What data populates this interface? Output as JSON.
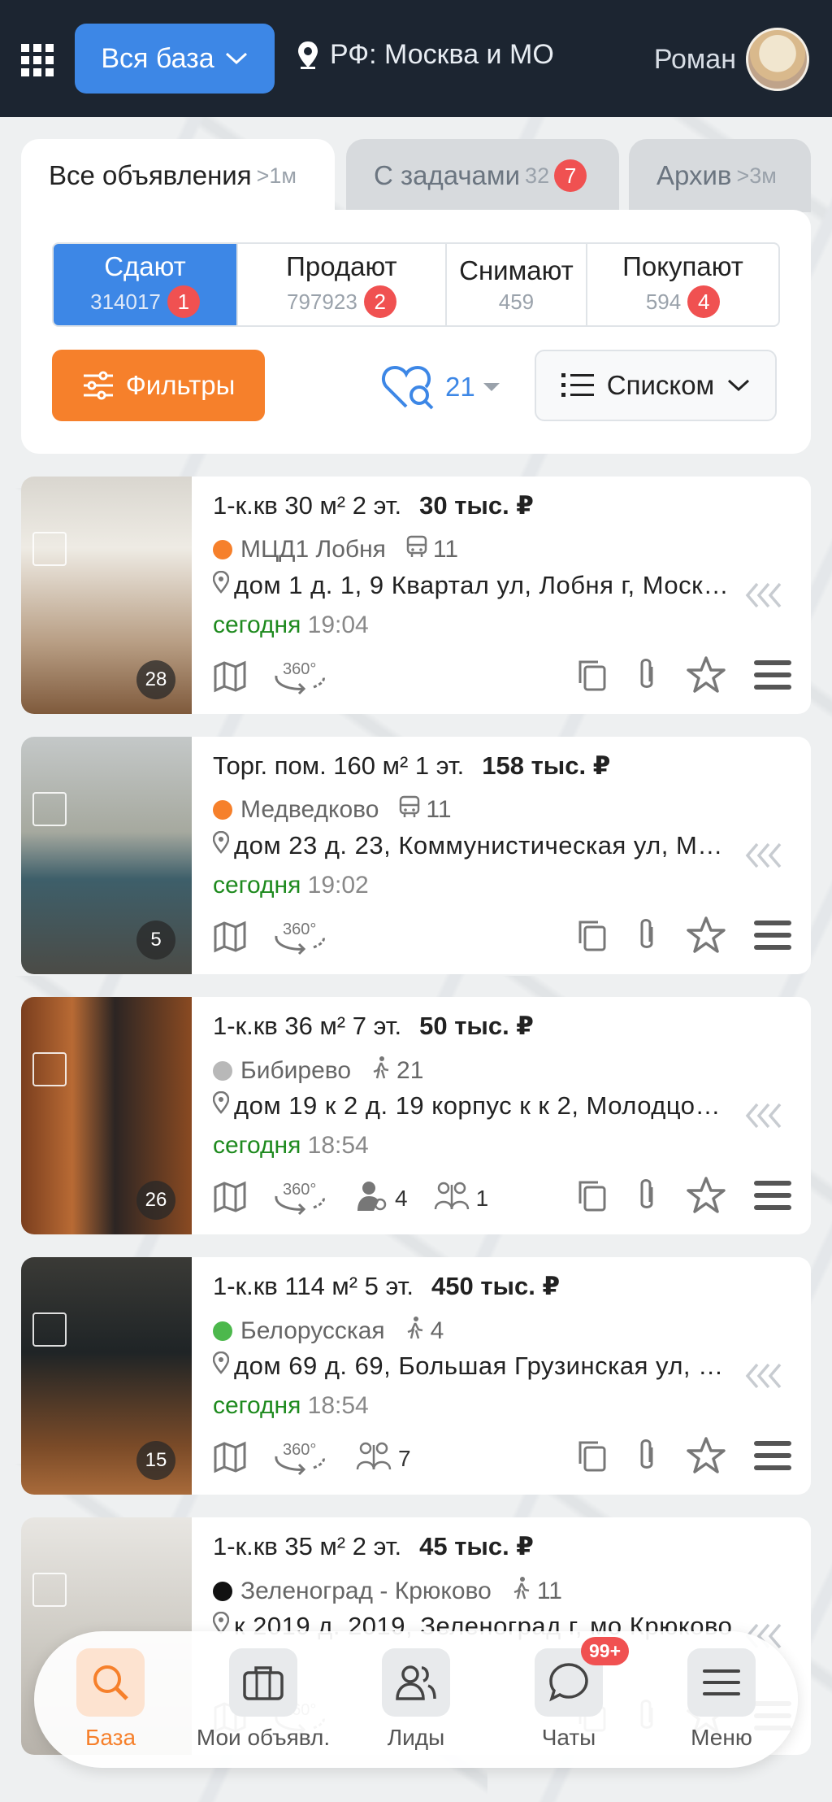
{
  "topbar": {
    "base_label": "Вся база",
    "location": "РФ: Москва и МО",
    "user_name": "Роман"
  },
  "tabs": [
    {
      "label": "Все объявления",
      "count": ">1м"
    },
    {
      "label": "С задачами",
      "count": "32",
      "badge": "7"
    },
    {
      "label": "Архив",
      "count": ">3м"
    }
  ],
  "segments": [
    {
      "label": "Сдают",
      "count": "314017",
      "badge": "1"
    },
    {
      "label": "Продают",
      "count": "797923",
      "badge": "2"
    },
    {
      "label": "Снимают",
      "count": "459"
    },
    {
      "label": "Покупают",
      "count": "594",
      "badge": "4"
    }
  ],
  "filters_label": "Фильтры",
  "favorites_count": "21",
  "view_label": "Списком",
  "listings": [
    {
      "title": "1-к.кв 30 м² 2 эт.",
      "price": "30 тыс. ₽",
      "metro": "МЦД1 Лобня",
      "metro_color": "#f6802b",
      "transit_time": "11",
      "address": "дом 1 д. 1, 9 Квартал ул, Лобня г, Моско…",
      "date": "сегодня",
      "time": "19:04",
      "photos": "28",
      "extras": []
    },
    {
      "title": "Торг. пом. 160 м² 1 эт.",
      "price": "158 тыс. ₽",
      "metro": "Медведково",
      "metro_color": "#f6802b",
      "transit_time": "11",
      "address": "дом 23 д. 23, Коммунистическая ул, Мыт…",
      "date": "сегодня",
      "time": "19:02",
      "photos": "5",
      "extras": []
    },
    {
      "title": "1-к.кв 36 м² 7 эт.",
      "price": "50 тыс. ₽",
      "metro": "Бибирево",
      "metro_color": "#b8b8b8",
      "transit_time": "21",
      "address": "дом 19 к 2 д. 19 корпус к к 2, Молодцов…",
      "date": "сегодня",
      "time": "18:54",
      "photos": "26",
      "extras": [
        {
          "icon": "agent-icon",
          "count": "4"
        },
        {
          "icon": "people-icon",
          "count": "1"
        }
      ]
    },
    {
      "title": "1-к.кв 114 м² 5 эт.",
      "price": "450 тыс. ₽",
      "metro": "Белорусская",
      "metro_color": "#4cb84c",
      "transit_time": "4",
      "address": "дом 69 д. 69, Большая Грузинская ул, мо…",
      "date": "сегодня",
      "time": "18:54",
      "photos": "15",
      "extras": [
        {
          "icon": "people-icon",
          "count": "7"
        }
      ]
    },
    {
      "title": "1-к.кв 35 м² 2 эт.",
      "price": "45 тыс. ₽",
      "metro": "Зеленоград - Крюково",
      "metro_color": "#111111",
      "transit_time": "11",
      "address": "к 2019 д. 2019, Зеленоград г, мо Крюково",
      "date": "",
      "time": "",
      "photos": "",
      "extras": []
    }
  ],
  "bottom_nav": [
    {
      "label": "База",
      "icon": "search-icon"
    },
    {
      "label": "Мои объявл.",
      "icon": "briefcase-icon"
    },
    {
      "label": "Лиды",
      "icon": "users-icon"
    },
    {
      "label": "Чаты",
      "icon": "chat-icon",
      "badge": "99+"
    },
    {
      "label": "Меню",
      "icon": "menu-icon"
    }
  ]
}
